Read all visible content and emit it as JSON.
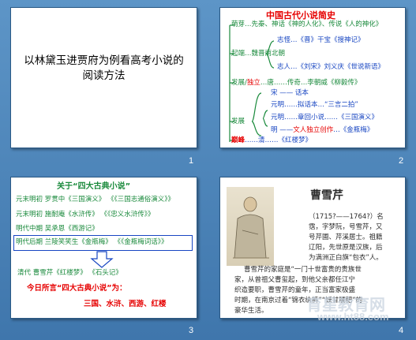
{
  "slides": [
    {
      "number": "1",
      "title": "以林黛玉进贾府为例看高考小说的阅读方法"
    },
    {
      "number": "2",
      "title": "中国古代小说简史",
      "items": {
        "a1": "萌芽…先秦、神话《神的人化》、传说《人的神化》",
        "a2": "起端…魏晋南北朝",
        "a3": "志怪…《晋》干宝《搜神记》",
        "a4": "志人…《刘宋》刘义庆《世说新语》",
        "a5_prefix": "发展/",
        "a5_red": "独立",
        "a5_suffix": "…唐……传奇…李朝威《柳毅传》",
        "b1": "宋 —— 话本",
        "b2": "元明……拟话本…“三言二拍”",
        "b3": "元明……章回小说……《三国演义》",
        "b4": "明 ——",
        "b4_red": "文人独立创作",
        "b4_suffix": "…《金瓶梅》",
        "b_label": "发展",
        "c_red": "巅峰",
        "c_suffix": "……清……《红楼梦》"
      }
    },
    {
      "number": "3",
      "title": "关于“四大古典小说”",
      "rows": [
        {
          "left": "元末明初",
          "mid": "罗贯中《三国演义》",
          "right": "《《三国志通俗演义》》"
        },
        {
          "left": "元末明初",
          "mid": "施耐庵《水浒传》",
          "right": "《《忠义水浒传》》"
        },
        {
          "left": "明代中期",
          "mid": "吴承恩《西游记》",
          "right": ""
        },
        {
          "left": "明代后期",
          "mid": "兰陵笑笑生《金瓶梅》",
          "right": "《《金瓶梅词话》》"
        }
      ],
      "qing": "清代         曹雪芹《红楼梦》 《石头记》",
      "today": "今日所言“四大古典小说”为：",
      "answer": "三国、水浒、西游、红楼"
    },
    {
      "number": "4",
      "title": "曹雪芹",
      "bio": [
        "（1715?——1764?）名",
        "霑，字梦阮，号雪芹，又",
        "号芹圃、芹溪居士。祖籍",
        "辽阳，先世原是汉族，后",
        "为满洲正白旗“包衣”人。"
      ],
      "para": [
        "曹雪芹的家庭是“一门十世富贵的贵族世",
        "家，从曾祖父曹玺起，到他父亲都任江宁",
        "织造要职，曹雪芹的童年，正当富家极盛",
        "时期，在南京过着“锦衣纨裤”“饫甘餍肥”的",
        "豪华生活。"
      ]
    }
  ],
  "watermark": {
    "line1": "育星教育网",
    "line2": "www.ht88.com"
  },
  "colors": {
    "background": "#4f86b8",
    "green": "#1a8a3c",
    "red": "#e60000",
    "blue": "#1846c2"
  }
}
